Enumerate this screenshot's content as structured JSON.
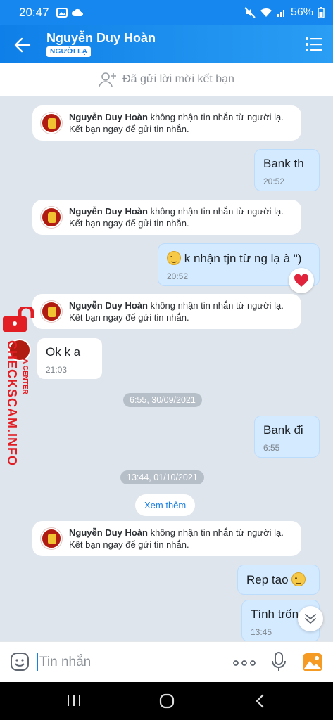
{
  "status": {
    "time": "20:47",
    "battery": "56%"
  },
  "header": {
    "title": "Nguyễn Duy Hoàn",
    "badge": "NGƯỜI LẠ"
  },
  "friend_request": {
    "text": "Đã gửi lời mời kết bạn"
  },
  "notice": {
    "name": "Nguyễn Duy Hoàn",
    "text_1": " không nhận tin nhắn từ người lạ.",
    "text_2": "Kết bạn ngay để gửi tin nhắn."
  },
  "messages": [
    {
      "text": "Bank th",
      "time": "20:52"
    },
    {
      "text": "k nhận tjn từ ng lạ à \")",
      "time": "20:52"
    },
    {
      "text": "Ok k a",
      "time": "21:03"
    },
    {
      "text": "Bank đi",
      "time": "6:55"
    },
    {
      "text": "Rep tao",
      "time": ""
    },
    {
      "text": "Tính trốn",
      "time": "13:45"
    }
  ],
  "dates": [
    "6:55, 30/09/2021",
    "13:44, 01/10/2021"
  ],
  "see_more": "Xem thêm",
  "composer": {
    "placeholder": "Tin nhắn"
  },
  "watermark": {
    "brand": "CHECKSCAM.INFO",
    "sub": "A CENTER"
  }
}
